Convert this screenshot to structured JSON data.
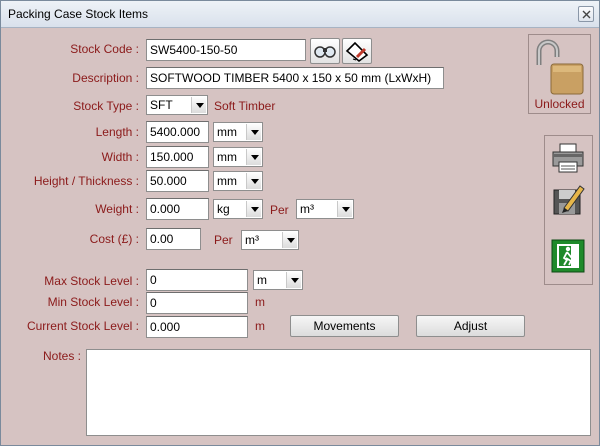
{
  "window": {
    "title": "Packing Case Stock Items"
  },
  "fields": {
    "stock_code": {
      "label": "Stock Code :",
      "value": "SW5400-150-50"
    },
    "description": {
      "label": "Description :",
      "value": "SOFTWOOD TIMBER 5400 x 150 x 50 mm (LxWxH)"
    },
    "stock_type": {
      "label": "Stock Type :",
      "value": "SFT",
      "text": "Soft Timber"
    },
    "length": {
      "label": "Length :",
      "value": "5400.000",
      "unit": "mm"
    },
    "width": {
      "label": "Width :",
      "value": "150.000",
      "unit": "mm"
    },
    "height": {
      "label": "Height / Thickness :",
      "value": "50.000",
      "unit": "mm"
    },
    "weight": {
      "label": "Weight :",
      "value": "0.000",
      "unit": "kg",
      "per_label": "Per",
      "per_unit": "m³"
    },
    "cost": {
      "label": "Cost (£) :",
      "value": "0.00",
      "per_label": "Per",
      "per_unit": "m³"
    },
    "max_stock": {
      "label": "Max Stock Level :",
      "value": "0",
      "unit": "m"
    },
    "min_stock": {
      "label": "Min Stock Level :",
      "value": "0",
      "unit": "m"
    },
    "current_stock": {
      "label": "Current Stock Level :",
      "value": "0.000",
      "unit": "m"
    },
    "notes": {
      "label": "Notes :",
      "value": ""
    }
  },
  "buttons": {
    "movements": "Movements",
    "adjust": "Adjust"
  },
  "lock": {
    "label": "Unlocked",
    "icon": "padlock-open-icon"
  },
  "side_icons": [
    "printer-icon",
    "save-edit-icon",
    "exit-icon"
  ],
  "colors": {
    "background": "#d6c3c2",
    "label": "#8b1a1a",
    "exit_green": "#1f8a2a"
  }
}
